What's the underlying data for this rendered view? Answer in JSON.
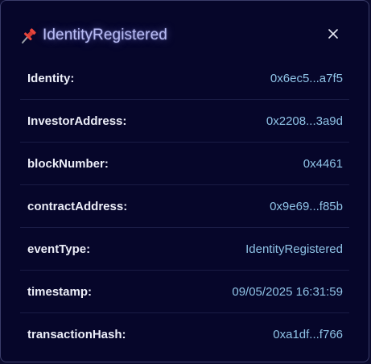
{
  "dialog": {
    "title": "IdentityRegistered",
    "icons": {
      "title": "pushpin-icon",
      "close": "close-icon"
    },
    "colors": {
      "title": "#b9bcf5",
      "value": "#8fc3e6",
      "label": "#eceef8",
      "background": "#06062a"
    }
  },
  "rows": [
    {
      "label": "Identity:",
      "value": "0x6ec5...a7f5"
    },
    {
      "label": "InvestorAddress:",
      "value": "0x2208...3a9d"
    },
    {
      "label": "blockNumber:",
      "value": "0x4461"
    },
    {
      "label": "contractAddress:",
      "value": "0x9e69...f85b"
    },
    {
      "label": "eventType:",
      "value": "IdentityRegistered"
    },
    {
      "label": "timestamp:",
      "value": "09/05/2025 16:31:59"
    },
    {
      "label": "transactionHash:",
      "value": "0xa1df...f766"
    }
  ]
}
